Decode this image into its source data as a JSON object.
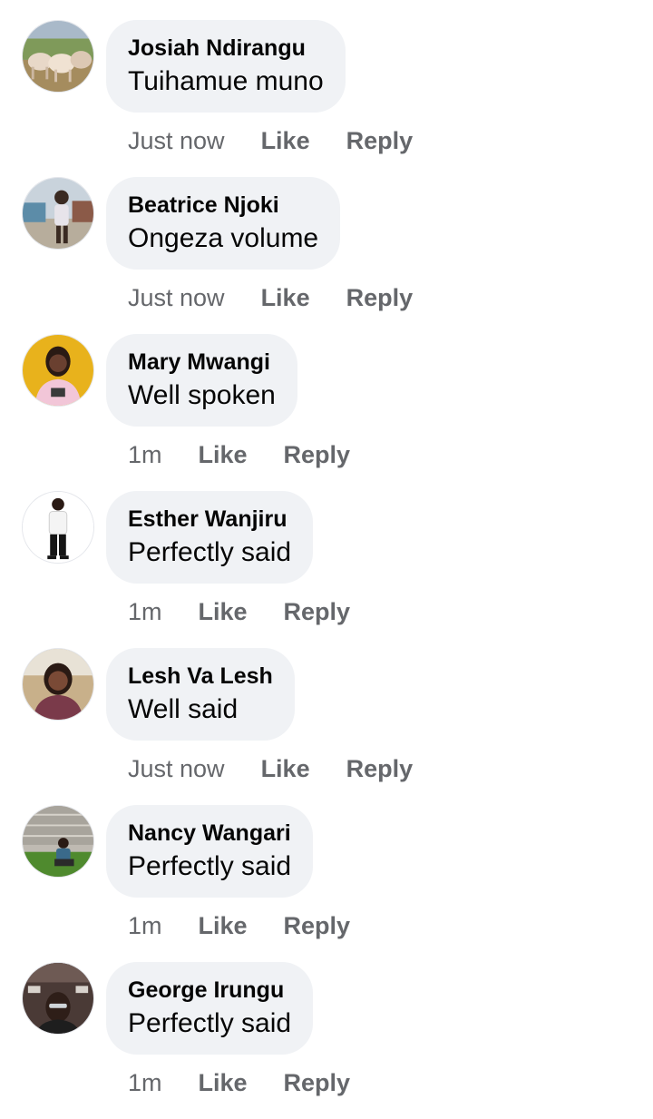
{
  "comments": [
    {
      "author": "Josiah Ndirangu",
      "text": "Tuihamue muno",
      "time": "Just now",
      "like": "Like",
      "reply": "Reply"
    },
    {
      "author": "Beatrice Njoki",
      "text": "Ongeza volume",
      "time": "Just now",
      "like": "Like",
      "reply": "Reply"
    },
    {
      "author": "Mary Mwangi",
      "text": "Well spoken",
      "time": "1m",
      "like": "Like",
      "reply": "Reply"
    },
    {
      "author": "Esther Wanjiru",
      "text": "Perfectly said",
      "time": "1m",
      "like": "Like",
      "reply": "Reply"
    },
    {
      "author": "Lesh Va Lesh",
      "text": "Well said",
      "time": "Just now",
      "like": "Like",
      "reply": "Reply"
    },
    {
      "author": "Nancy Wangari",
      "text": "Perfectly said",
      "time": "1m",
      "like": "Like",
      "reply": "Reply"
    },
    {
      "author": "George Irungu",
      "text": "Perfectly said",
      "time": "1m",
      "like": "Like",
      "reply": "Reply"
    }
  ],
  "colors": {
    "bubble": "#f0f2f5",
    "text": "#050505",
    "meta": "#65676b"
  }
}
